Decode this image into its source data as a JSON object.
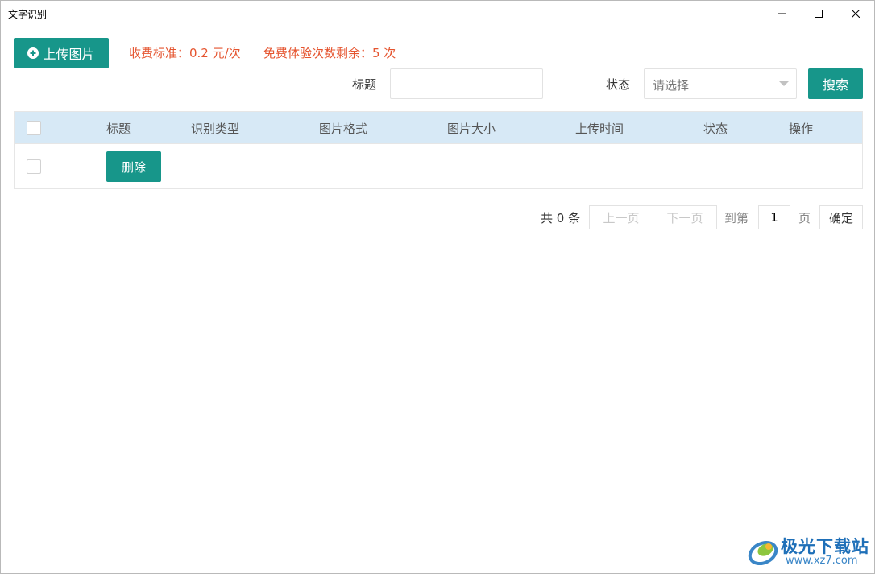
{
  "window": {
    "title": "文字识别"
  },
  "toolbar": {
    "upload_label": "上传图片",
    "fee_rate": "收费标准：0.2 元/次",
    "free_trials": "免费体验次数剩余：5 次"
  },
  "filters": {
    "title_label": "标题",
    "title_value": "",
    "status_label": "状态",
    "status_placeholder": "请选择",
    "search_label": "搜索"
  },
  "table": {
    "columns": [
      "标题",
      "识别类型",
      "图片格式",
      "图片大小",
      "上传时间",
      "状态",
      "操作"
    ],
    "row_action": "删除"
  },
  "pagination": {
    "total": "共 0 条",
    "prev": "上一页",
    "next": "下一页",
    "goto_label": "到第",
    "page_value": "1",
    "page_suffix": "页",
    "confirm": "确定"
  },
  "watermark": {
    "name": "极光下载站",
    "url": "www.xz7.com"
  },
  "colors": {
    "primary": "#17968a",
    "notice": "#e5542f",
    "table_header": "#d7e9f6"
  },
  "icons": {
    "upload": "plus-circle-icon",
    "minimize": "minimize-icon",
    "maximize": "maximize-icon",
    "close": "close-icon",
    "dropdown": "caret-down-icon"
  }
}
